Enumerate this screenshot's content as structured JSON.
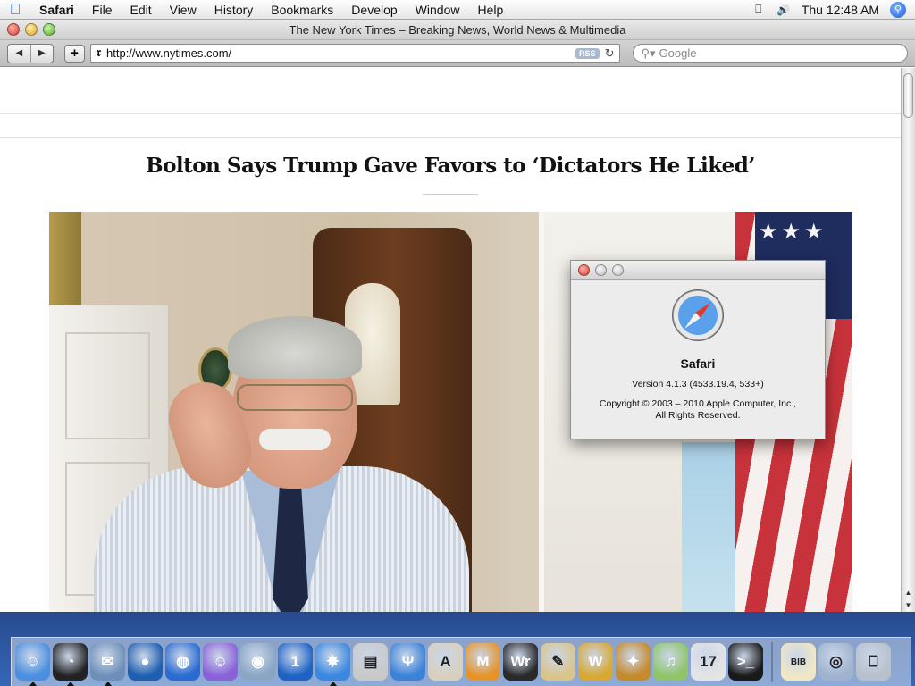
{
  "menubar": {
    "app_name": "Safari",
    "items": [
      "File",
      "Edit",
      "View",
      "History",
      "Bookmarks",
      "Develop",
      "Window",
      "Help"
    ],
    "clock": "Thu 12:48 AM"
  },
  "window": {
    "title": "The New York Times – Breaking News, World News & Multimedia",
    "url": "http://www.nytimes.com/",
    "rss_label": "RSS",
    "search_placeholder": "Google"
  },
  "page": {
    "headline": "Bolton Says Trump Gave Favors to ‘Dictators He Liked’"
  },
  "about_dialog": {
    "app_name": "Safari",
    "version": "Version 4.1.3 (4533.19.4, 533+)",
    "copyright_line1": "Copyright © 2003 – 2010 Apple Computer, Inc.,",
    "copyright_line2": "All Rights Reserved."
  },
  "dock": {
    "icons": [
      {
        "name": "finder-icon",
        "glyph": "☺",
        "color": "#4a8fe0",
        "running": true
      },
      {
        "name": "dashboard-icon",
        "glyph": "◔",
        "color": "#222222",
        "running": true
      },
      {
        "name": "mail-icon",
        "glyph": "✉",
        "color": "#6d8fb8",
        "running": true
      },
      {
        "name": "network-globe-icon",
        "glyph": "●",
        "color": "#1f5fb0",
        "running": false
      },
      {
        "name": "firefox-icon",
        "glyph": "◍",
        "color": "#2b6bd1",
        "running": false
      },
      {
        "name": "ichat-icon",
        "glyph": "☺",
        "color": "#8a62d8",
        "running": false
      },
      {
        "name": "macos-orb-icon",
        "glyph": "◉",
        "color": "#8aa6c4",
        "running": false
      },
      {
        "name": "onepassword-icon",
        "glyph": "1",
        "color": "#1e63c4",
        "running": false
      },
      {
        "name": "safari-icon",
        "glyph": "✵",
        "color": "#3a88e0",
        "running": true
      },
      {
        "name": "preview-icon",
        "glyph": "▤",
        "color": "#c9c9c9",
        "running": false
      },
      {
        "name": "fork-icon",
        "glyph": "Ψ",
        "color": "#3c83d8",
        "running": false
      },
      {
        "name": "textedit-icon",
        "glyph": "A",
        "color": "#d8d0bf",
        "running": false
      },
      {
        "name": "m-app-icon",
        "glyph": "M",
        "color": "#e5942b",
        "running": false
      },
      {
        "name": "wr-app-icon",
        "glyph": "Wr",
        "color": "#2a2a2a",
        "running": false
      },
      {
        "name": "script-editor-icon",
        "glyph": "✎",
        "color": "#d9c58c",
        "running": false
      },
      {
        "name": "wu-app-icon",
        "glyph": "W",
        "color": "#d7a834",
        "running": false
      },
      {
        "name": "photo-editor-icon",
        "glyph": "✦",
        "color": "#c58a2a",
        "running": false
      },
      {
        "name": "itunes-icon",
        "glyph": "♫",
        "color": "#8fc46a",
        "running": false
      },
      {
        "name": "ical-icon",
        "glyph": "17",
        "color": "#e4e4e4",
        "running": false
      },
      {
        "name": "terminal-icon",
        "glyph": ">_",
        "color": "#1a1a1a",
        "running": false
      }
    ],
    "right_icons": [
      {
        "name": "bib-document-icon",
        "glyph": "BIB",
        "color": "#efe7c6"
      },
      {
        "name": "downloads-stack-icon",
        "glyph": "◎",
        "color": "#9fb3cf"
      },
      {
        "name": "trash-icon",
        "glyph": "⎕",
        "color": "#b7c0cc"
      }
    ]
  }
}
